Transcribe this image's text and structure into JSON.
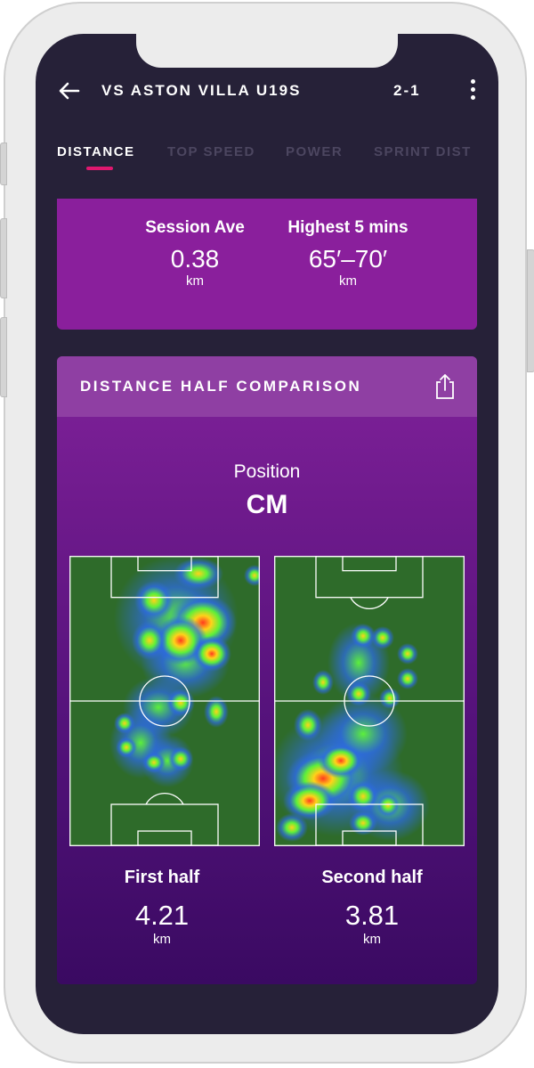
{
  "header": {
    "title": "VS ASTON VILLA U19S",
    "score": "2-1"
  },
  "tabs": [
    {
      "label": "DISTANCE",
      "active": true
    },
    {
      "label": "TOP SPEED",
      "active": false
    },
    {
      "label": "POWER",
      "active": false
    },
    {
      "label": "SPRINT DIST",
      "active": false
    }
  ],
  "summary": {
    "session_ave": {
      "label": "Session Ave",
      "value": "0.38",
      "unit": "km"
    },
    "highest_5": {
      "label": "Highest 5 mins",
      "value": "65′–70′",
      "unit": "km"
    }
  },
  "comparison": {
    "title": "DISTANCE HALF COMPARISON",
    "position_label": "Position",
    "position_value": "CM",
    "first_half": {
      "label": "First half",
      "value": "4.21",
      "unit": "km"
    },
    "second_half": {
      "label": "Second half",
      "value": "3.81",
      "unit": "km"
    }
  },
  "colors": {
    "accent": "#e0186f",
    "card": "#8a1f9c",
    "background": "#262138",
    "pitch": "#2e6b2a"
  },
  "icons": [
    "back-arrow-icon",
    "more-vertical-icon",
    "share-icon"
  ]
}
